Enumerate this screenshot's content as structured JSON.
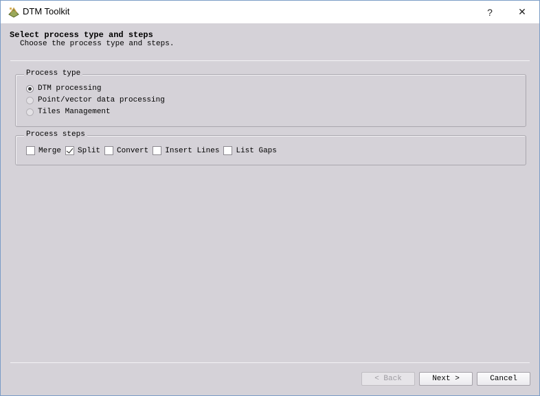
{
  "window": {
    "title": "DTM Toolkit",
    "help_label": "?",
    "close_label": "✕"
  },
  "header": {
    "title": "Select process type and steps",
    "subtitle": "Choose the process type and steps."
  },
  "process_type": {
    "legend": "Process type",
    "options": [
      {
        "label": "DTM processing",
        "selected": true
      },
      {
        "label": "Point/vector data processing",
        "selected": false
      },
      {
        "label": "Tiles Management",
        "selected": false
      }
    ]
  },
  "process_steps": {
    "legend": "Process steps",
    "items": [
      {
        "label": "Merge",
        "checked": false
      },
      {
        "label": "Split",
        "checked": true
      },
      {
        "label": "Convert",
        "checked": false
      },
      {
        "label": "Insert Lines",
        "checked": false
      },
      {
        "label": "List Gaps",
        "checked": false
      }
    ]
  },
  "buttons": {
    "back": "< Back",
    "next": "Next >",
    "cancel": "Cancel"
  }
}
